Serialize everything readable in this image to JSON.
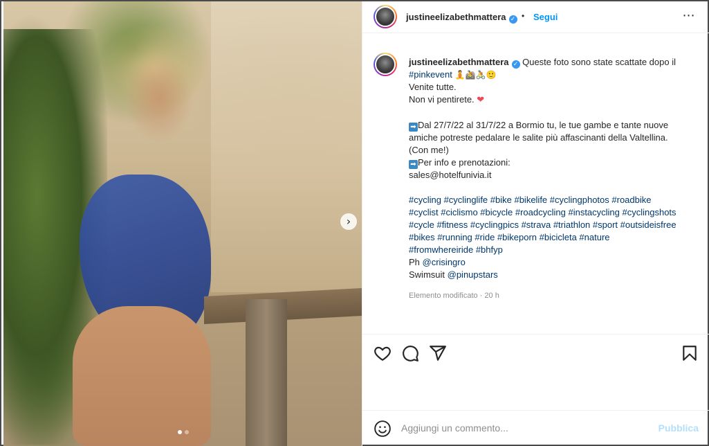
{
  "post": {
    "username": "justineelizabethmattera",
    "verified_badge": "✓",
    "separator": "•",
    "follow_label": "Segui",
    "more_icon": "⋯",
    "carousel_next": "›"
  },
  "caption": {
    "username": "justineelizabethmattera",
    "intro": " Queste foto sono state scattate dopo il",
    "hashtag_event": "#pinkevent",
    "emojis_1": " 🧘🚵🚴🙂",
    "line2": "Venite tutte.",
    "line3": "Non vi pentirete. ",
    "heart": "❤",
    "arrow": "➡",
    "para2_a": "Dal 27/7/22 al 31/7/22 a Bormio tu, le tue gambe e tante nuove",
    "para2_b": "amiche potreste pedalare le salite più affascinanti della Valtellina.",
    "para2_c": "(Con me!)",
    "info_label": "Per info e prenotazioni:",
    "email": "sales@hotelfunivia.it",
    "hashtags_1": "#cycling #cyclinglife #bike #bikelife #cyclingphotos #roadbike",
    "hashtags_2": "#cyclist #ciclismo #bicycle #roadcycling #instacycling #cyclingshots",
    "hashtags_3": "#cycle #fitness #cyclingpics #strava #triathlon #sport #outsideisfree",
    "hashtags_4": "#bikes #running #ride #bikeporn #bicicleta #nature",
    "hashtags_5": "#fromwhereiride #bhfyp",
    "ph_label": "Ph ",
    "ph_handle": "@crisingro",
    "swim_label": "Swimsuit ",
    "swim_handle": "@pinupstars",
    "meta": "Elemento modificato · 20 h"
  },
  "actions": {
    "like_icon": "heart-outline",
    "comment_icon": "speech-bubble",
    "share_icon": "paper-plane",
    "save_icon": "bookmark-outline"
  },
  "comment": {
    "placeholder": "Aggiungi un commento...",
    "publish_label": "Pubblica"
  },
  "carousel": {
    "slide_count": 2,
    "active_index": 0
  }
}
